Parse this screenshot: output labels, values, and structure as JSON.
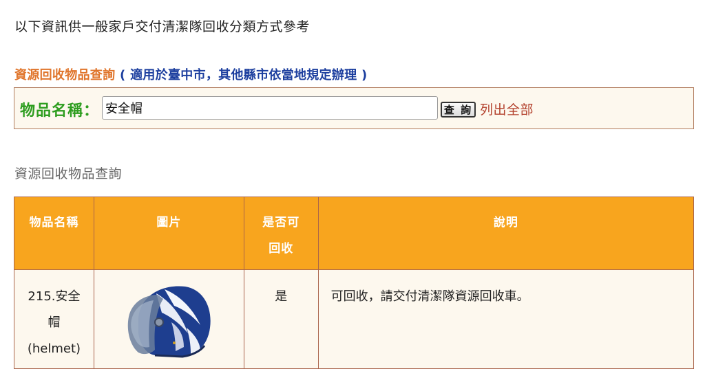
{
  "intro": "以下資訊供一般家戶交付清潔隊回收分類方式參考",
  "search": {
    "title": "資源回收物品查詢",
    "note": "( 適用於臺中市，其他縣市依當地規定辦理 )",
    "label": "物品名稱：",
    "value": "安全帽",
    "button": "查 詢",
    "list_all": "列出全部"
  },
  "results": {
    "title": "資源回收物品查詢",
    "headers": {
      "name": "物品名稱",
      "image": "圖片",
      "recyclable_l1": "是否可",
      "recyclable_l2": "回收",
      "description": "說明"
    },
    "rows": [
      {
        "name_l1": "215.安全",
        "name_l2": "帽",
        "name_l3": "(helmet)",
        "image_icon": "helmet-image",
        "recyclable": "是",
        "description": "可回收，請交付清潔隊資源回收車。"
      }
    ]
  },
  "colors": {
    "header_bg": "#f8a51e",
    "search_title": "#e0752b",
    "search_note": "#1d3f9f",
    "search_label": "#2d9d1f",
    "list_all": "#b3402c"
  }
}
